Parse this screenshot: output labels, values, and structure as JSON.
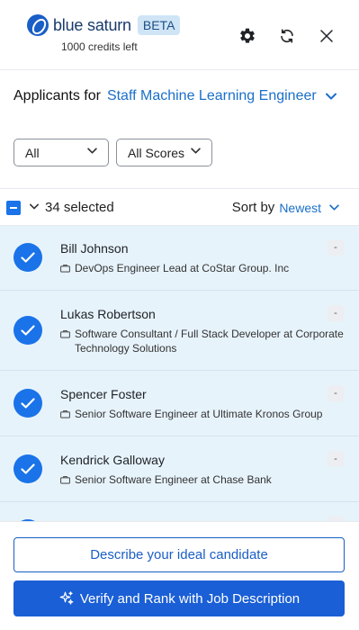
{
  "header": {
    "brand": "blue saturn",
    "badge": "BETA",
    "credits": "1000 credits left",
    "icons": [
      "settings-icon",
      "refresh-icon",
      "close-icon"
    ]
  },
  "applicants": {
    "label": "Applicants for",
    "job_title": "Staff Machine Learning Engineer"
  },
  "filters": {
    "status": "All",
    "scores": "All Scores"
  },
  "selection": {
    "count": "34 selected",
    "sort_label": "Sort by",
    "sort_value": "Newest"
  },
  "candidates": [
    {
      "name": "Bill Johnson",
      "title": "DevOps Engineer Lead at CoStar Group. Inc",
      "score": "-",
      "selected": true
    },
    {
      "name": "Lukas Robertson",
      "title": "Software Consultant / Full Stack Developer at Corporate Technology Solutions",
      "score": "-",
      "selected": true
    },
    {
      "name": "Spencer Foster",
      "title": "Senior Software Engineer at Ultimate Kronos Group",
      "score": "-",
      "selected": true
    },
    {
      "name": "Kendrick Galloway",
      "title": "Senior Software Engineer at Chase Bank",
      "score": "-",
      "selected": true
    }
  ],
  "actions": {
    "describe": "Describe your ideal candidate",
    "verify": "Verify and Rank with Job Description"
  },
  "colors": {
    "accent": "#1a73e8",
    "row_bg": "#e7f3fb",
    "link": "#1a6fc9"
  }
}
